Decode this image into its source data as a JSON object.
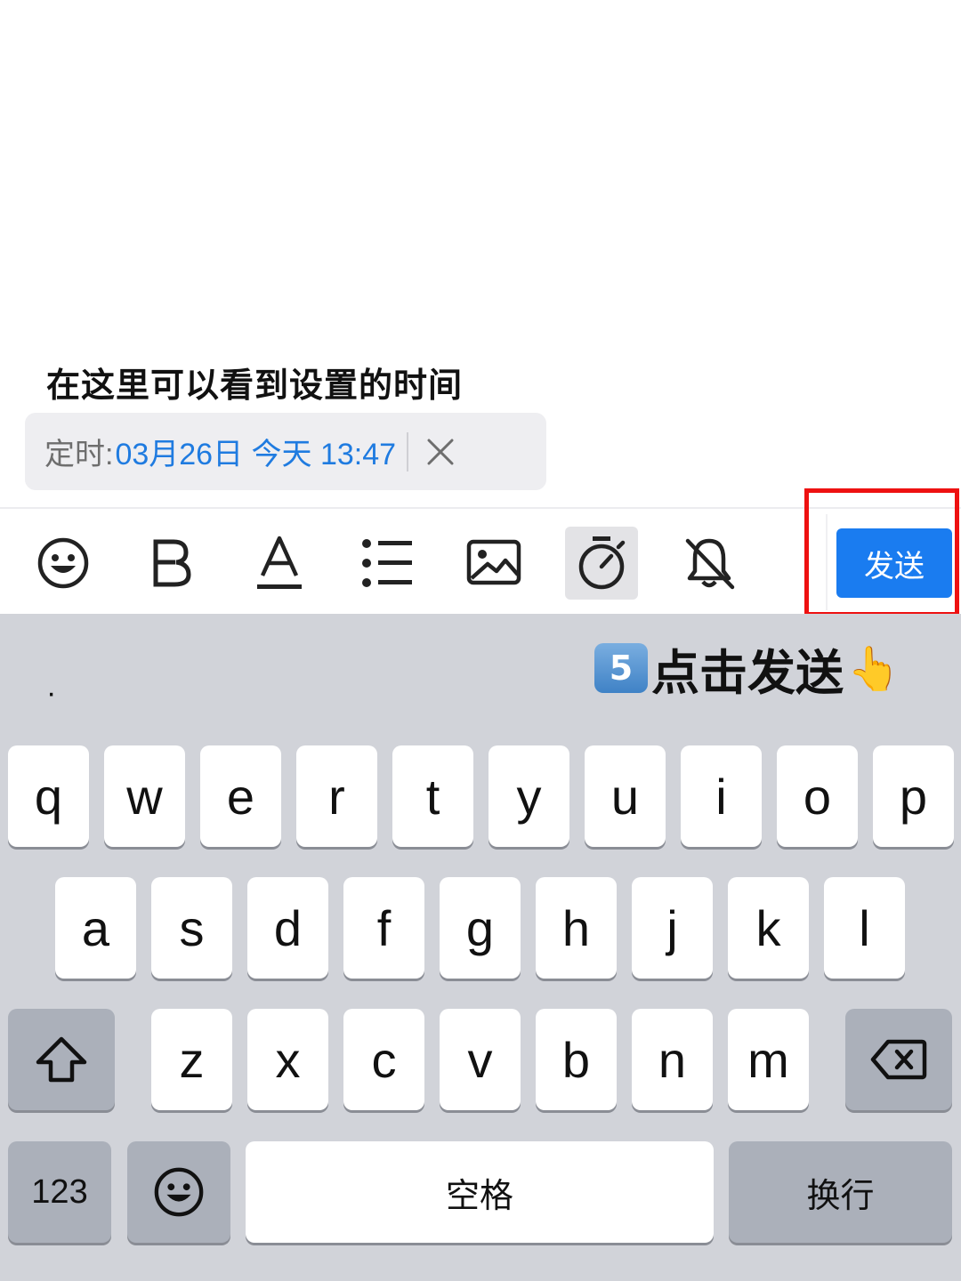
{
  "annotation": {
    "heading": "在这里可以看到设置的时间",
    "step_number": "5",
    "step_text": "点击发送",
    "step_hand": "👆"
  },
  "timer": {
    "label": "定时:",
    "value": "03月26日 今天 13:47"
  },
  "toolbar": {
    "send_label": "发送",
    "icons": [
      "emoji-icon",
      "bold-icon",
      "text-color-icon",
      "list-icon",
      "image-icon",
      "timer-icon",
      "mute-bell-icon"
    ]
  },
  "keyboard": {
    "suggestion": "·",
    "row1": [
      "q",
      "w",
      "e",
      "r",
      "t",
      "y",
      "u",
      "i",
      "o",
      "p"
    ],
    "row2": [
      "a",
      "s",
      "d",
      "f",
      "g",
      "h",
      "j",
      "k",
      "l"
    ],
    "row3": [
      "z",
      "x",
      "c",
      "v",
      "b",
      "n",
      "m"
    ],
    "numbers_label": "123",
    "space_label": "空格",
    "return_label": "换行"
  },
  "colors": {
    "accent": "#1a7cf0",
    "timer_text": "#1f7be0",
    "highlight": "#ee1111",
    "keyboard_bg": "#d1d3d9"
  }
}
